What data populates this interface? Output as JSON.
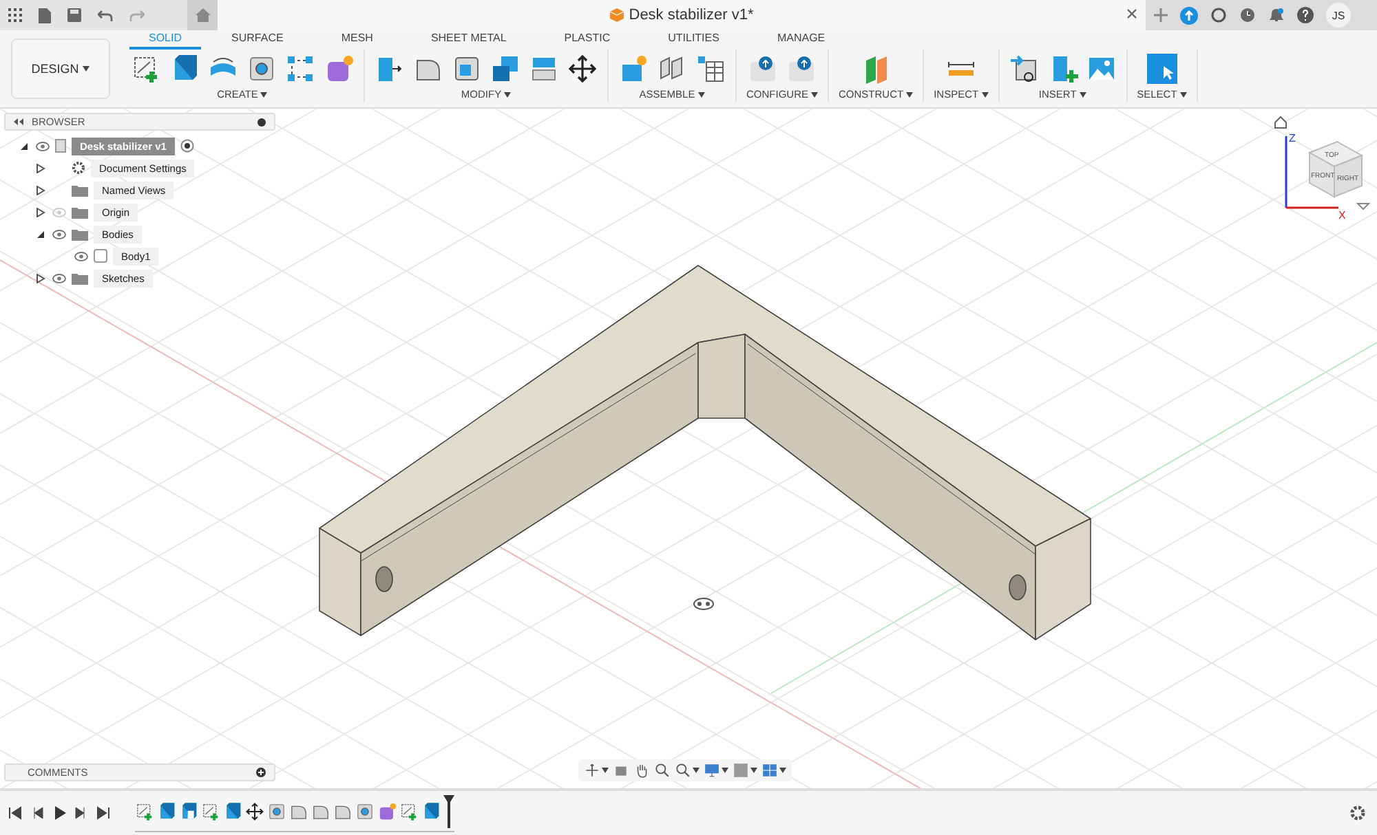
{
  "document_tab": {
    "title": "Desk stabilizer v1*"
  },
  "user": {
    "initials": "JS"
  },
  "workspace": {
    "label": "DESIGN"
  },
  "tabs": [
    {
      "label": "SOLID",
      "selected": true
    },
    {
      "label": "SURFACE",
      "selected": false
    },
    {
      "label": "MESH",
      "selected": false
    },
    {
      "label": "SHEET METAL",
      "selected": false
    },
    {
      "label": "PLASTIC",
      "selected": false
    },
    {
      "label": "UTILITIES",
      "selected": false
    },
    {
      "label": "MANAGE",
      "selected": false
    }
  ],
  "groups": [
    {
      "label": "CREATE",
      "tools": [
        {
          "kind": "sketch"
        },
        {
          "kind": "extrude"
        },
        {
          "kind": "revolve"
        },
        {
          "kind": "hole"
        },
        {
          "kind": "pattern"
        },
        {
          "kind": "form"
        }
      ]
    },
    {
      "label": "MODIFY",
      "tools": [
        {
          "kind": "presspull"
        },
        {
          "kind": "fillet"
        },
        {
          "kind": "shell"
        },
        {
          "kind": "combine"
        },
        {
          "kind": "split"
        },
        {
          "kind": "move"
        }
      ]
    },
    {
      "label": "ASSEMBLE",
      "tools": [
        {
          "kind": "component"
        },
        {
          "kind": "joint"
        },
        {
          "kind": "table"
        }
      ]
    },
    {
      "label": "CONFIGURE",
      "tools": [
        {
          "kind": "configure"
        },
        {
          "kind": "configtable"
        }
      ]
    },
    {
      "label": "CONSTRUCT",
      "tools": [
        {
          "kind": "plane"
        }
      ]
    },
    {
      "label": "INSPECT",
      "tools": [
        {
          "kind": "measure"
        }
      ]
    },
    {
      "label": "INSERT",
      "tools": [
        {
          "kind": "derive"
        },
        {
          "kind": "insert"
        },
        {
          "kind": "canvas"
        }
      ]
    },
    {
      "label": "SELECT",
      "tools": [
        {
          "kind": "select"
        }
      ]
    }
  ],
  "browser": {
    "title": "BROWSER",
    "items": [
      {
        "label": "Desk stabilizer v1",
        "kind": "component",
        "visible": true,
        "expanded": true,
        "active": true,
        "selected": true,
        "children": [
          {
            "label": "Document Settings",
            "kind": "settings",
            "expanded": false,
            "selected": false
          },
          {
            "label": "Named Views",
            "kind": "folder",
            "expanded": false,
            "selected": false
          },
          {
            "label": "Origin",
            "kind": "folder",
            "visible": false,
            "expanded": false,
            "selected": false
          },
          {
            "label": "Bodies",
            "kind": "folder",
            "visible": true,
            "expanded": true,
            "selected": false,
            "children": [
              {
                "label": "Body1",
                "kind": "body",
                "visible": true,
                "selected": false
              }
            ]
          },
          {
            "label": "Sketches",
            "kind": "folder",
            "visible": true,
            "expanded": false,
            "selected": false
          }
        ]
      }
    ]
  },
  "viewcube": {
    "faces": [
      "TOP",
      "FRONT",
      "RIGHT"
    ],
    "axes": [
      "Z",
      "X"
    ]
  },
  "comments": {
    "title": "COMMENTS"
  },
  "navbar": [
    {
      "kind": "orbit"
    },
    {
      "kind": "look"
    },
    {
      "kind": "pan"
    },
    {
      "kind": "zoomwin"
    },
    {
      "kind": "zoom"
    },
    {
      "kind": "display"
    },
    {
      "kind": "visual"
    },
    {
      "kind": "grid"
    }
  ],
  "timeline": [
    {
      "kind": "sketch"
    },
    {
      "kind": "extrude"
    },
    {
      "kind": "cut"
    },
    {
      "kind": "sketch"
    },
    {
      "kind": "extrude"
    },
    {
      "kind": "move"
    },
    {
      "kind": "hole"
    },
    {
      "kind": "chamfer"
    },
    {
      "kind": "chamfer"
    },
    {
      "kind": "chamfer"
    },
    {
      "kind": "hole"
    },
    {
      "kind": "form"
    },
    {
      "kind": "sketch"
    },
    {
      "kind": "extrude"
    }
  ]
}
